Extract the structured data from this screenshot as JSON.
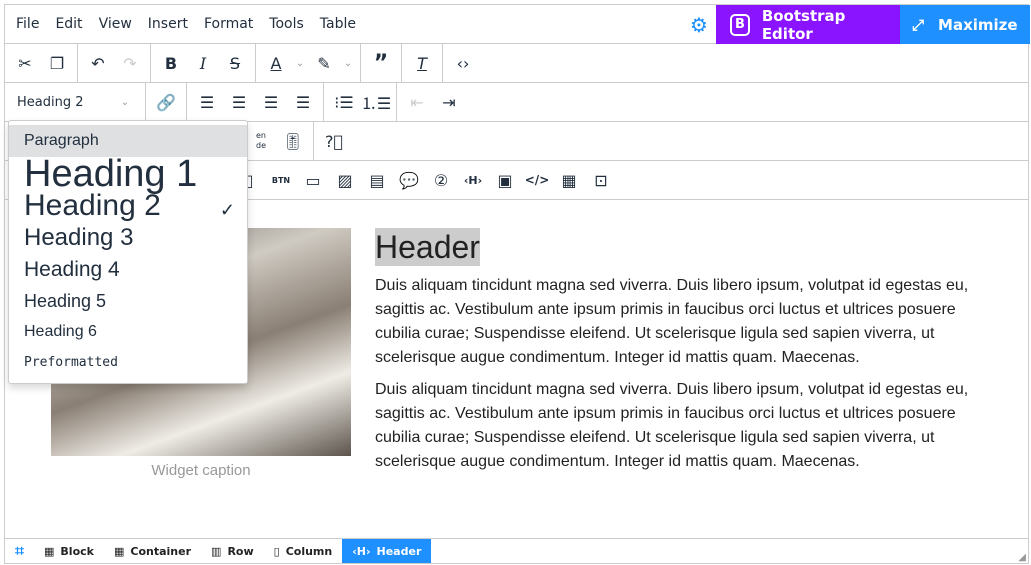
{
  "menubar": {
    "items": [
      "File",
      "Edit",
      "View",
      "Insert",
      "Format",
      "Tools",
      "Table"
    ],
    "bootstrap_editor": "Bootstrap Editor",
    "maximize": "Maximize"
  },
  "toolbar": {
    "format_select": "Heading 2",
    "translate_top": "en",
    "translate_bottom": "de"
  },
  "format_dropdown": {
    "items": [
      "Paragraph",
      "Heading 1",
      "Heading 2",
      "Heading 3",
      "Heading 4",
      "Heading 5",
      "Heading 6",
      "Preformatted"
    ],
    "selected": "Heading 2",
    "highlighted": "Paragraph"
  },
  "content": {
    "caption": "Widget caption",
    "header": "Header",
    "paragraphs": [
      "Duis aliquam tincidunt magna sed viverra. Duis libero ipsum, volutpat id egestas eu, sagittis ac. Vestibulum ante ipsum primis in faucibus orci luctus et ultrices posuere cubilia curae; Suspendisse eleifend. Ut scelerisque ligula sed sapien viverra, ut scelerisque augue condimentum. Integer id mattis quam. Maecenas.",
      "Duis aliquam tincidunt magna sed viverra. Duis libero ipsum, volutpat id egestas eu, sagittis ac. Vestibulum ante ipsum primis in faucibus orci luctus et ultrices posuere cubilia curae; Suspendisse eleifend. Ut scelerisque ligula sed sapien viverra, ut scelerisque augue condimentum. Integer id mattis quam. Maecenas."
    ]
  },
  "statusbar": {
    "crumbs": [
      "Block",
      "Container",
      "Row",
      "Column",
      "Header"
    ],
    "active": "Header"
  },
  "colors": {
    "accent": "#1e90ff",
    "bootstrap": "#8a14ff"
  }
}
